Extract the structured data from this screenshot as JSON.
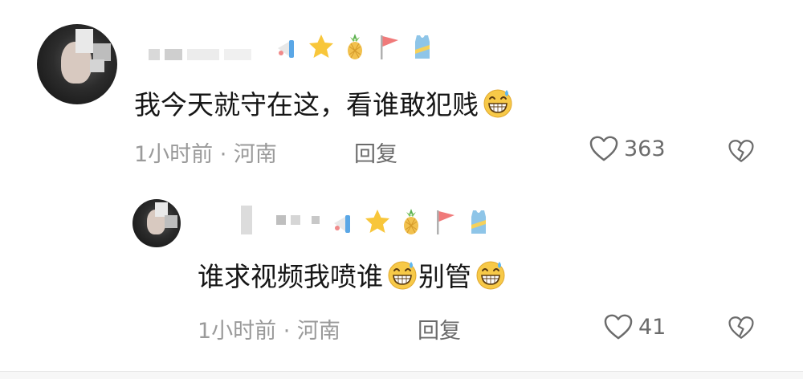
{
  "comments": [
    {
      "text": "我今天就守在这，看谁敢犯贱",
      "emoji": "grinning-sweat-emoji",
      "time_location": "1小时前 · 河南",
      "reply_label": "回复",
      "like_count": "363"
    },
    {
      "text_part1": "谁求视频我喷谁",
      "text_part2": "别管",
      "emoji": "grinning-sweat-emoji",
      "time_location": "1小时前 · 河南",
      "reply_label": "回复",
      "like_count": "41"
    }
  ],
  "badges": [
    "megaphone-badge",
    "star-badge",
    "pineapple-badge",
    "flag-badge",
    "tanktop-badge"
  ],
  "colors": {
    "text": "#161616",
    "meta": "#9a9a9a",
    "action": "#6b6b6b",
    "emoji_face": "#f7c948"
  }
}
